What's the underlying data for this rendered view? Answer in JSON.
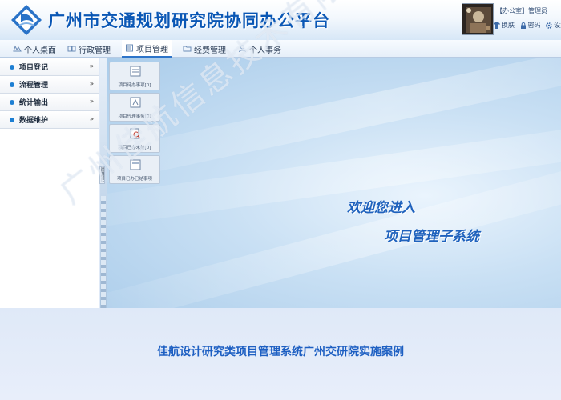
{
  "header": {
    "title": "广州市交通规划研究院协同办公平台",
    "user_role": "【办公室】管理员",
    "user_links": [
      {
        "label": "换肤",
        "icon": "shirt-icon"
      },
      {
        "label": "密码",
        "icon": "lock-icon"
      },
      {
        "label": "设置",
        "icon": "gear-icon"
      }
    ]
  },
  "nav": {
    "tabs": [
      {
        "label": "个人桌面",
        "icon": "desktop-icon"
      },
      {
        "label": "行政管理",
        "icon": "admin-icon"
      },
      {
        "label": "项目管理",
        "icon": "project-icon",
        "active": true
      },
      {
        "label": "经费管理",
        "icon": "folder-icon"
      },
      {
        "label": "个人事务",
        "icon": "person-icon"
      }
    ]
  },
  "sidebar": {
    "items": [
      {
        "label": "项目登记"
      },
      {
        "label": "流程管理"
      },
      {
        "label": "统计输出"
      },
      {
        "label": "数据维护"
      }
    ],
    "handle_label": "隐藏目录"
  },
  "quick_cards": [
    {
      "label": "项目待办事项[0]"
    },
    {
      "label": "项目代理事务[0]"
    },
    {
      "label": "项目已办未结[0]"
    },
    {
      "label": "项目已办已结事项"
    }
  ],
  "main": {
    "welcome_line1": "欢迎您进入",
    "welcome_line2": "项目管理子系统"
  },
  "footer": {
    "caption": "佳航设计研究类项目管理系统广州交研院实施案例"
  },
  "watermark": "广州佳航信息技术有限公司",
  "colors": {
    "brand_blue": "#0a57b5",
    "accent_blue": "#1f62bd",
    "sidebar_dot": "#1d7fd3"
  }
}
